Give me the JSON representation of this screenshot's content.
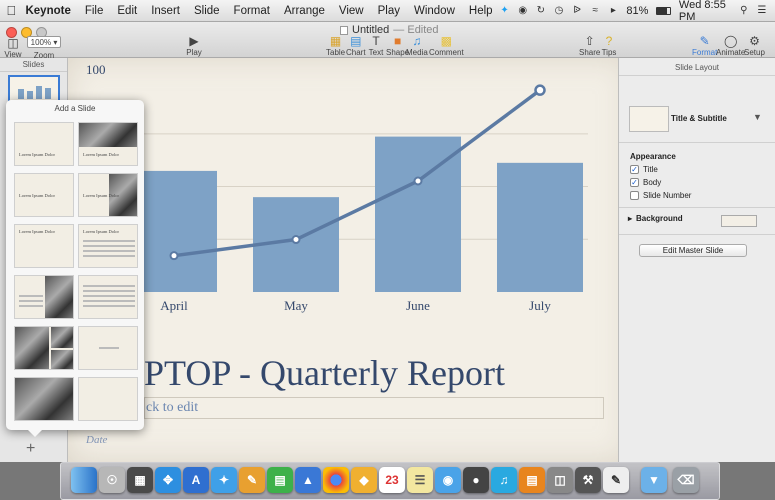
{
  "menubar": {
    "apple_icon": "apple-logo-icon",
    "items": [
      "Keynote",
      "File",
      "Edit",
      "Insert",
      "Slide",
      "Format",
      "Arrange",
      "View",
      "Play",
      "Window",
      "Help"
    ],
    "battery": "81%",
    "clock": "Wed 8:55 PM"
  },
  "window": {
    "title": "Untitled",
    "title_status": "— Edited",
    "zoom_value": "100%",
    "toolbar_left": [
      {
        "label": "View",
        "icon": "sidebar-icon"
      },
      {
        "label": "Zoom",
        "icon": "zoom-icon"
      }
    ],
    "toolbar_play": {
      "label": "Play",
      "icon": "play-icon"
    },
    "toolbar_insert": [
      {
        "label": "Table",
        "icon": "table-icon"
      },
      {
        "label": "Chart",
        "icon": "chart-icon"
      },
      {
        "label": "Text",
        "icon": "text-icon"
      },
      {
        "label": "Shape",
        "icon": "shape-icon"
      },
      {
        "label": "Media",
        "icon": "media-icon"
      },
      {
        "label": "Comment",
        "icon": "comment-icon"
      }
    ],
    "toolbar_share": [
      {
        "label": "Share",
        "icon": "share-icon"
      },
      {
        "label": "Tips",
        "icon": "tips-icon"
      }
    ],
    "toolbar_right": [
      {
        "label": "Format",
        "icon": "format-brush-icon"
      },
      {
        "label": "Animate",
        "icon": "animate-icon"
      },
      {
        "label": "Setup",
        "icon": "setup-icon"
      }
    ]
  },
  "navigator": {
    "header": "Slides"
  },
  "slide": {
    "title": "PTOP - Quarterly Report",
    "subtitle_placeholder": "ck to edit",
    "date": "Date"
  },
  "chart_data": {
    "type": "bar",
    "categories": [
      "April",
      "May",
      "June",
      "July"
    ],
    "series": [
      {
        "type": "bar",
        "values": [
          60,
          47,
          77,
          64
        ]
      },
      {
        "type": "line",
        "values": [
          18,
          26,
          55,
          100
        ]
      }
    ],
    "ytick_visible": "100",
    "ylim": [
      0,
      110
    ],
    "colors": {
      "bar": "#7ea2c6",
      "line": "#5b7aa3"
    }
  },
  "inspector": {
    "header": "Slide Layout",
    "layout_name": "Title & Subtitle",
    "appearance_label": "Appearance",
    "checks": [
      {
        "label": "Title",
        "checked": true
      },
      {
        "label": "Body",
        "checked": true
      },
      {
        "label": "Slide Number",
        "checked": false
      }
    ],
    "background_label": "Background",
    "edit_master_label": "Edit Master Slide"
  },
  "popover": {
    "title": "Add a Slide",
    "layout_text": "Lorem Ipsum Dolor",
    "layouts": [
      "Title & Subtitle",
      "Photo - Horizontal",
      "Title - Center",
      "Photo - Vertical",
      "Title - Top",
      "Title, Bullets & Photo",
      "Bullets",
      "Photo - 3 Up",
      "Quote",
      "Photo",
      "Blank"
    ]
  },
  "dock": {
    "apps": [
      "finder",
      "launchpad",
      "mission-control",
      "safari",
      "app-store",
      "twitter",
      "pages",
      "numbers",
      "keynote",
      "chrome",
      "sketch",
      "calendar",
      "notes",
      "messages",
      "facetime",
      "itunes",
      "ibooks",
      "preview",
      "xcode",
      "textedit",
      "downloads",
      "trash"
    ]
  }
}
